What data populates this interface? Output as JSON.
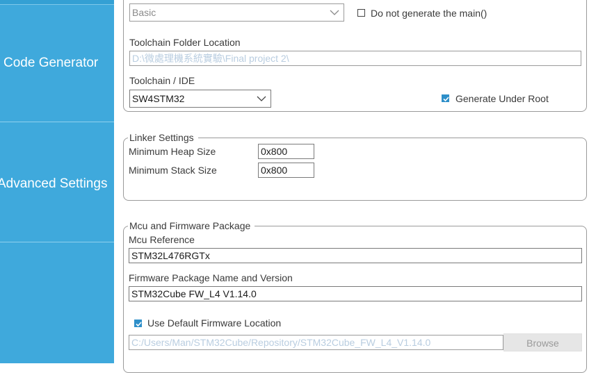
{
  "sidebar": {
    "items": [
      {
        "label": "Code Generator"
      },
      {
        "label": "Advanced Settings"
      }
    ]
  },
  "project": {
    "mode_select": "Basic",
    "no_main_label": "Do not generate the main()",
    "toolchain_folder_label": "Toolchain Folder Location",
    "toolchain_folder_value": "D:\\微處理機系統實驗\\Final project 2\\",
    "toolchain_ide_label": "Toolchain / IDE",
    "toolchain_ide_value": "SW4STM32",
    "generate_under_root_label": "Generate Under Root",
    "generate_under_root_checked": true,
    "no_main_checked": false
  },
  "linker": {
    "legend": "Linker Settings",
    "heap_label": "Minimum Heap Size",
    "heap_value": "0x800",
    "stack_label": "Minimum Stack Size",
    "stack_value": "0x800"
  },
  "mcu": {
    "legend": "Mcu and Firmware Package",
    "mcu_ref_label": "Mcu Reference",
    "mcu_ref_value": "STM32L476RGTx",
    "fw_label": "Firmware Package Name and Version",
    "fw_value": "STM32Cube FW_L4 V1.14.0",
    "use_default_label": "Use Default Firmware Location",
    "use_default_checked": true,
    "fw_location_value": "C:/Users/Man/STM32Cube/Repository/STM32Cube_FW_L4_V1.14.0",
    "browse_label": "Browse"
  },
  "colors": {
    "sidebar_bg": "#3fa9dc",
    "checkbox_accent": "#2e8fc9"
  }
}
